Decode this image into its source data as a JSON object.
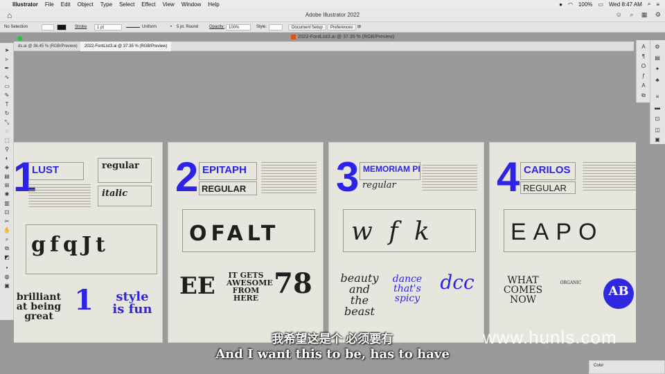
{
  "menubar": {
    "app": "Illustrator",
    "items": [
      "File",
      "Edit",
      "Object",
      "Type",
      "Select",
      "Effect",
      "View",
      "Window",
      "Help"
    ],
    "battery": "100%",
    "clock": "Wed 8:47 AM"
  },
  "titlebar": {
    "title": "Adobe Illustrator 2022"
  },
  "controlbar": {
    "selection": "No Selection",
    "stroke_label": "Stroke",
    "stroke_value": "1 pt",
    "uniform": "Uniform",
    "brush": "5 pt. Round",
    "opacity_label": "Opacity:",
    "opacity_value": "100%",
    "style_label": "Style:",
    "document_setup": "Document Setup",
    "preferences": "Preferences"
  },
  "document": {
    "title": "2022-FontList3.ai @ 37.35 % (RGB/Preview)",
    "tabs": [
      "ds.ai @ 36.45 % (RGB/Preview)",
      "2022-FontList3.ai @ 37.35 % (RGB/Preview)"
    ]
  },
  "artboards": [
    {
      "number": "1",
      "font": "LUST",
      "style_a": "regular",
      "style_b": "italic",
      "glyphs": "gfqJt",
      "sample_a": "brilliant at being great",
      "sample_b": "1",
      "sample_c": "style is fun"
    },
    {
      "number": "2",
      "font": "EPITAPH",
      "style_a": "REGULAR",
      "glyphs": "OFALT",
      "sample_a": "EE",
      "sample_b": "IT GETS AWESOME FROM HERE",
      "sample_c": "78"
    },
    {
      "number": "3",
      "font": "MEMORIAM PRO",
      "style_a": "regular",
      "glyphs": "w f k",
      "sample_a": "beauty and the beast",
      "sample_b": "dance that's spicy",
      "sample_c": "dcc"
    },
    {
      "number": "4",
      "font": "CARILOS",
      "style_a": "REGULAR",
      "glyphs": "EAPO",
      "sample_a": "WHAT COMES NOW",
      "sample_b": "ORGANIC",
      "sample_c": "AB"
    }
  ],
  "subtitles": {
    "chinese": "我希望这是个 必须要有",
    "english": "And I want this to be, has to have"
  },
  "watermark": "www.hunls.com",
  "panels": {
    "color": "Color"
  }
}
